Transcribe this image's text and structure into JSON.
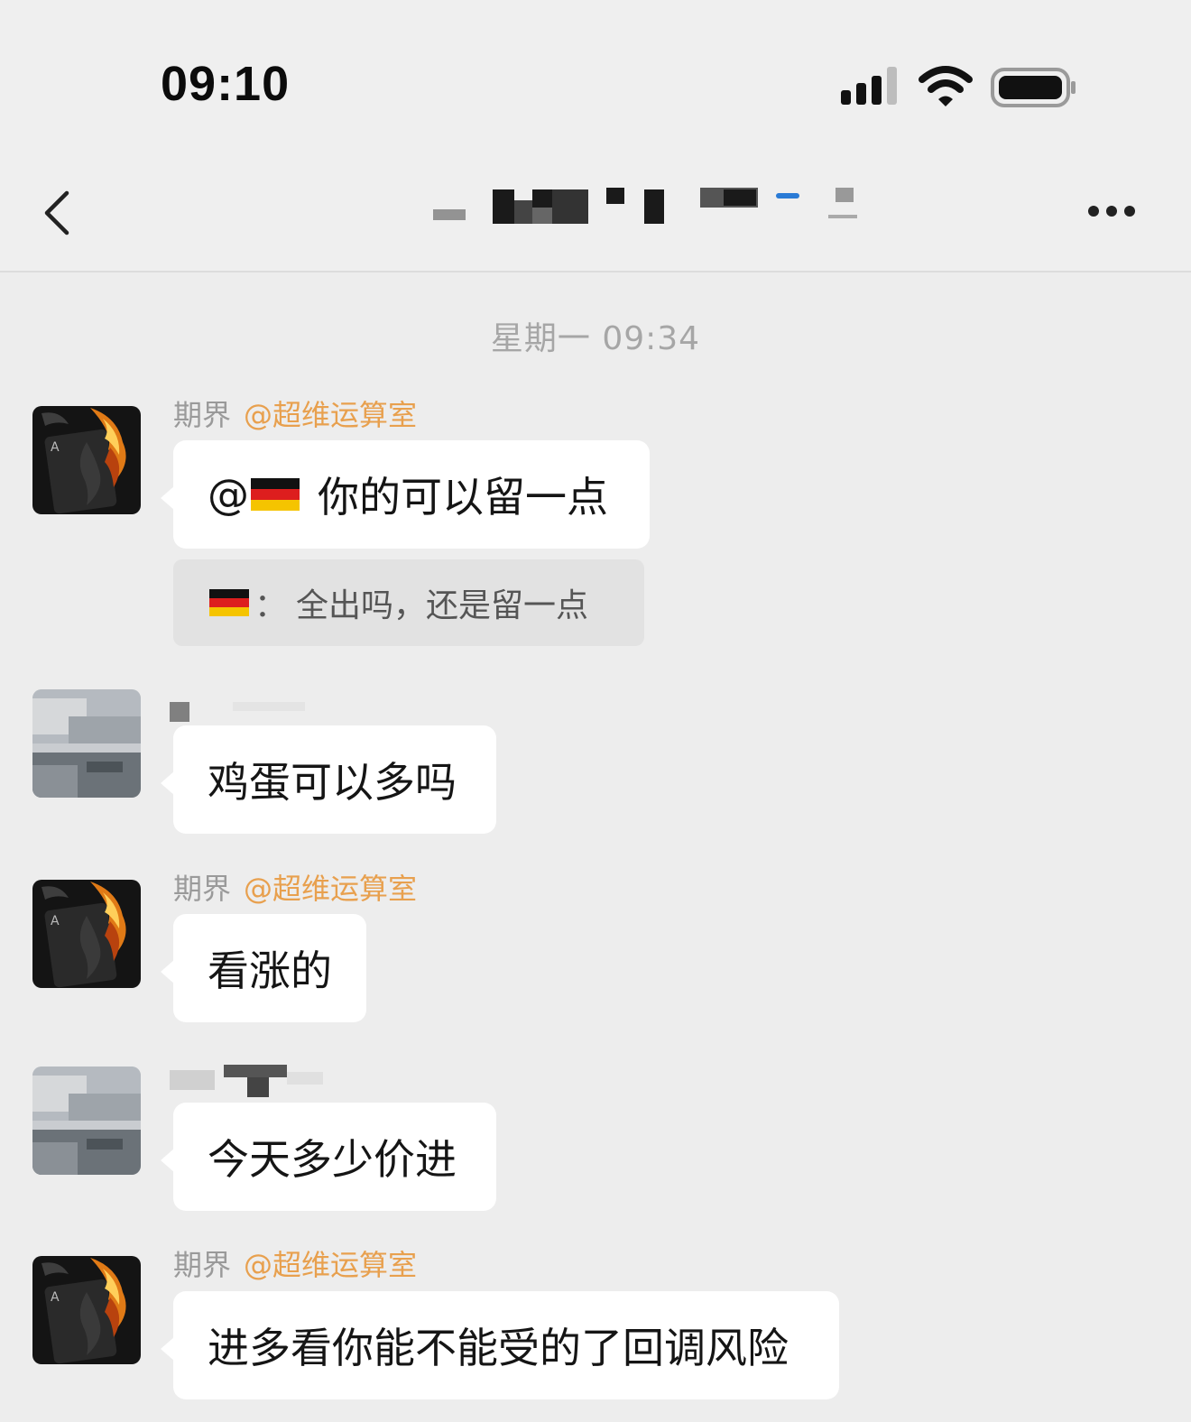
{
  "status_bar": {
    "time": "09:10"
  },
  "nav": {
    "back_icon": "chevron-left-icon",
    "more_icon": "more-dots-icon"
  },
  "chat": {
    "timestamp": "星期一 09:34",
    "messages": [
      {
        "sender": "期界",
        "tag": "@超维运算室",
        "text_prefix": "@",
        "text": "你的可以留一点",
        "quote_sep": "：",
        "quote": "全出吗，还是留一点"
      },
      {
        "sender": "",
        "text": "鸡蛋可以多吗"
      },
      {
        "sender": "期界",
        "tag": "@超维运算室",
        "text": "看涨的"
      },
      {
        "sender": "",
        "text": "今天多少价进"
      },
      {
        "sender": "期界",
        "tag": "@超维运算室",
        "text": "进多看你能不能受的了回调风险"
      }
    ]
  },
  "colors": {
    "background": "#ededed",
    "bubble": "#ffffff",
    "quote": "#e2e2e2",
    "tag": "#e8a04e",
    "meta_text": "#9a9a9a"
  }
}
